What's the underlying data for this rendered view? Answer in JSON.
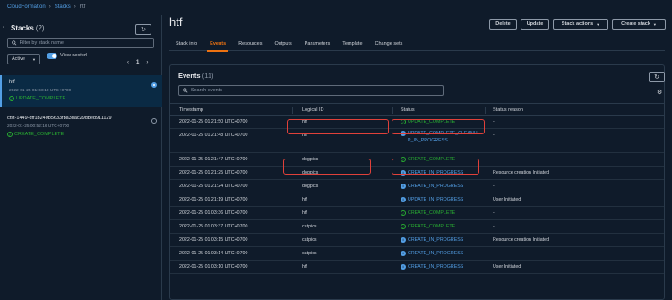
{
  "breadcrumb": {
    "root": "CloudFormation",
    "section": "Stacks",
    "current": "htf"
  },
  "left_panel": {
    "title": "Stacks",
    "count": "(2)",
    "search_placeholder": "Filter by stack name",
    "filter_value": "Active",
    "view_nested_label": "View nested",
    "page": "1",
    "stacks": [
      {
        "name": "htf",
        "date": "2022-01-25 01:03:10 UTC+0700",
        "status": "UPDATE_COMPLETE",
        "selected": true
      },
      {
        "name": "cfst-1449-dff1b240b5633fba3dac29dbed911129",
        "date": "2022-01-25 00:52:16 UTC+0700",
        "status": "CREATE_COMPLETE",
        "selected": false
      }
    ]
  },
  "main": {
    "title": "htf",
    "buttons": {
      "delete": "Delete",
      "update": "Update",
      "stack_actions": "Stack actions",
      "create_stack": "Create stack"
    },
    "tabs": [
      "Stack info",
      "Events",
      "Resources",
      "Outputs",
      "Parameters",
      "Template",
      "Change sets"
    ],
    "active_tab": "Events"
  },
  "events": {
    "title": "Events",
    "count": "(11)",
    "search_placeholder": "Search events",
    "columns": [
      "Timestamp",
      "Logical ID",
      "Status",
      "Status reason"
    ],
    "rows": [
      {
        "timestamp": "2022-01-25 01:21:50 UTC+0700",
        "logical_id": "htf",
        "status": "UPDATE_COMPLETE",
        "kind": "complete",
        "reason": "-"
      },
      {
        "timestamp": "2022-01-25 01:21:48 UTC+0700",
        "logical_id": "htf",
        "status": "UPDATE_COMPLETE_CLEANUP_IN_PROGRESS",
        "kind": "progress",
        "reason": "-"
      },
      {
        "timestamp": "2022-01-25 01:21:47 UTC+0700",
        "logical_id": "dogpics",
        "status": "CREATE_COMPLETE",
        "kind": "complete",
        "reason": "-"
      },
      {
        "timestamp": "2022-01-25 01:21:25 UTC+0700",
        "logical_id": "dogpics",
        "status": "CREATE_IN_PROGRESS",
        "kind": "progress",
        "reason": "Resource creation Initiated"
      },
      {
        "timestamp": "2022-01-25 01:21:24 UTC+0700",
        "logical_id": "dogpics",
        "status": "CREATE_IN_PROGRESS",
        "kind": "progress",
        "reason": "-"
      },
      {
        "timestamp": "2022-01-25 01:21:19 UTC+0700",
        "logical_id": "htf",
        "status": "UPDATE_IN_PROGRESS",
        "kind": "progress",
        "reason": "User Initiated"
      },
      {
        "timestamp": "2022-01-25 01:03:36 UTC+0700",
        "logical_id": "htf",
        "status": "CREATE_COMPLETE",
        "kind": "complete",
        "reason": "-"
      },
      {
        "timestamp": "2022-01-25 01:03:37 UTC+0700",
        "logical_id": "catpics",
        "status": "CREATE_COMPLETE",
        "kind": "complete",
        "reason": "-"
      },
      {
        "timestamp": "2022-01-25 01:03:15 UTC+0700",
        "logical_id": "catpics",
        "status": "CREATE_IN_PROGRESS",
        "kind": "progress",
        "reason": "Resource creation Initiated"
      },
      {
        "timestamp": "2022-01-25 01:03:14 UTC+0700",
        "logical_id": "catpics",
        "status": "CREATE_IN_PROGRESS",
        "kind": "progress",
        "reason": "-"
      },
      {
        "timestamp": "2022-01-25 01:03:10 UTC+0700",
        "logical_id": "htf",
        "status": "CREATE_IN_PROGRESS",
        "kind": "progress",
        "reason": "User Initiated"
      }
    ]
  },
  "colors": {
    "background": "#0f1b2a",
    "accent": "#ec7211",
    "link": "#539fe5",
    "success": "#29ad32",
    "highlight": "#e0413a"
  }
}
